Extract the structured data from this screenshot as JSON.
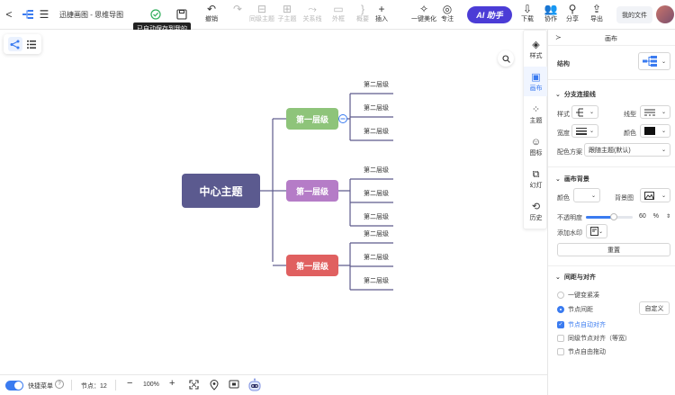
{
  "header": {
    "back_glyph": "<",
    "menu_glyph": "☰",
    "title": "迅捷画图 - 思维导图",
    "tooltip": "已自动保存到我的",
    "tools": [
      {
        "label": "撤销",
        "glyph": "↶"
      },
      {
        "label": "",
        "glyph": "↷"
      },
      {
        "label": "同级主题",
        "glyph": "⊟"
      },
      {
        "label": "子主题",
        "glyph": "⊞"
      },
      {
        "label": "关系线",
        "glyph": "⤳"
      },
      {
        "label": "外框",
        "glyph": "▭"
      },
      {
        "label": "概要",
        "glyph": "}"
      },
      {
        "label": "插入",
        "glyph": "+"
      },
      {
        "label": "一键美化",
        "glyph": "✧"
      },
      {
        "label": "专注",
        "glyph": "◎"
      }
    ],
    "ai_button": "AI 助手",
    "right": [
      {
        "label": "下载",
        "glyph": "⇩"
      },
      {
        "label": "协作",
        "glyph": "👥"
      },
      {
        "label": "分享",
        "glyph": "⚲"
      },
      {
        "label": "导出",
        "glyph": "⇪"
      }
    ],
    "my_files": "我的文件"
  },
  "mindmap": {
    "center": "中心主题",
    "branches": [
      {
        "label": "第一层级",
        "color": "#8ec47a",
        "children": [
          "第二层级",
          "第二层级",
          "第二层级"
        ]
      },
      {
        "label": "第一层级",
        "color": "#b57cc7",
        "children": [
          "第二层级",
          "第二层级",
          "第二层级"
        ]
      },
      {
        "label": "第一层级",
        "color": "#e06060",
        "children": [
          "第二层级",
          "第二层级",
          "第二层级"
        ]
      }
    ]
  },
  "side_tabs": [
    {
      "label": "样式",
      "glyph": "◈"
    },
    {
      "label": "画布",
      "glyph": "▣"
    },
    {
      "label": "主题",
      "glyph": "⁘"
    },
    {
      "label": "图标",
      "glyph": "☺"
    },
    {
      "label": "幻灯",
      "glyph": "⧉"
    },
    {
      "label": "历史",
      "glyph": "⟲"
    }
  ],
  "panel": {
    "collapse_glyph": "≻",
    "title": "画布",
    "structure_label": "结构",
    "branch_section": "分支连接线",
    "style_label": "样式",
    "line_type_label": "线型",
    "width_label": "宽度",
    "color_label": "颜色",
    "color_scheme_label": "配色方案",
    "color_scheme_value": "跟随主题(默认)",
    "bg_section": "画布背景",
    "bg_color_label": "颜色",
    "bg_image_label": "背景图",
    "opacity_label": "不透明度",
    "opacity_value": "60",
    "opacity_unit": "%",
    "opacity_fraction": 0.6,
    "watermark_label": "添加水印",
    "reset_button": "重置",
    "spacing_section": "间距与对齐",
    "opt_compact": "一键变紧凑",
    "opt_spacing": "节点间距",
    "custom_button": "自定义",
    "chk_auto_align": "节点自动对齐",
    "chk_same_level": "同级节点对齐（等宽）",
    "chk_free_drag": "节点自由拖动"
  },
  "bottom": {
    "shortcut_label": "快捷菜单",
    "help_glyph": "?",
    "node_count": "节点：12",
    "zoom_out": "−",
    "zoom": "100%",
    "zoom_in": "+"
  },
  "colors": {
    "accent": "#3a7bf0",
    "center_node": "#5b5a8f",
    "line": "#5d5a8c",
    "ai_button": "#4b3cd6"
  }
}
